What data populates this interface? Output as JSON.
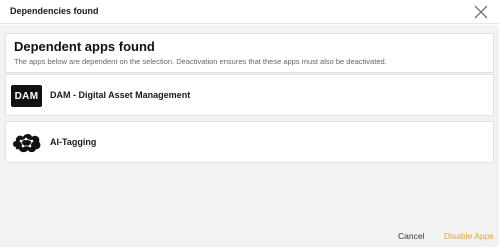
{
  "dialog": {
    "title": "Dependencies found",
    "close_icon": "close-icon"
  },
  "banner": {
    "title": "Dependent apps found",
    "description": "The apps below are dependent on the selection. Deactivation ensures that these apps must also be deactivated."
  },
  "apps": [
    {
      "logo_text": "DAM",
      "name": "DAM - Digital Asset Management",
      "icon": "dam-logo-icon"
    },
    {
      "name": "AI-Tagging",
      "icon": "ai-brain-icon"
    }
  ],
  "footer": {
    "cancel_label": "Cancel",
    "disable_label": "Disable Apps"
  },
  "colors": {
    "accent": "#f0a030",
    "background": "#f2f2f2",
    "card": "#ffffff"
  }
}
